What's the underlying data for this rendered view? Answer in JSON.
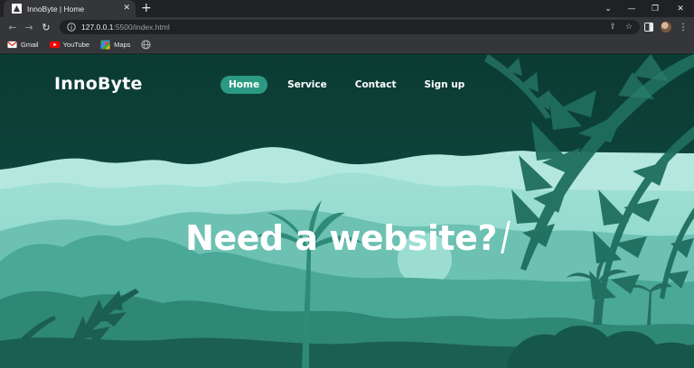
{
  "browser": {
    "tab": {
      "title": "InnoByte | Home"
    },
    "url": {
      "host": "127.0.0.1",
      "path": ":5500/index.html"
    },
    "bookmarks": [
      {
        "label": "Gmail",
        "icon": "gmail-icon"
      },
      {
        "label": "YouTube",
        "icon": "youtube-icon"
      },
      {
        "label": "Maps",
        "icon": "maps-icon"
      },
      {
        "label": "",
        "icon": "globe-icon"
      }
    ]
  },
  "site": {
    "logo": "InnoByte",
    "nav": [
      {
        "label": "Home",
        "active": true
      },
      {
        "label": "Service",
        "active": false
      },
      {
        "label": "Contact",
        "active": false
      },
      {
        "label": "Sign up",
        "active": false
      }
    ],
    "hero_title": "Need a website?"
  },
  "colors": {
    "page_bg": "#0c4239",
    "accent": "#2c9a83",
    "mountain_light": "#a9e3d9",
    "forest_mid": "#3f9e8b",
    "forest_dark": "#1c6b5d"
  }
}
